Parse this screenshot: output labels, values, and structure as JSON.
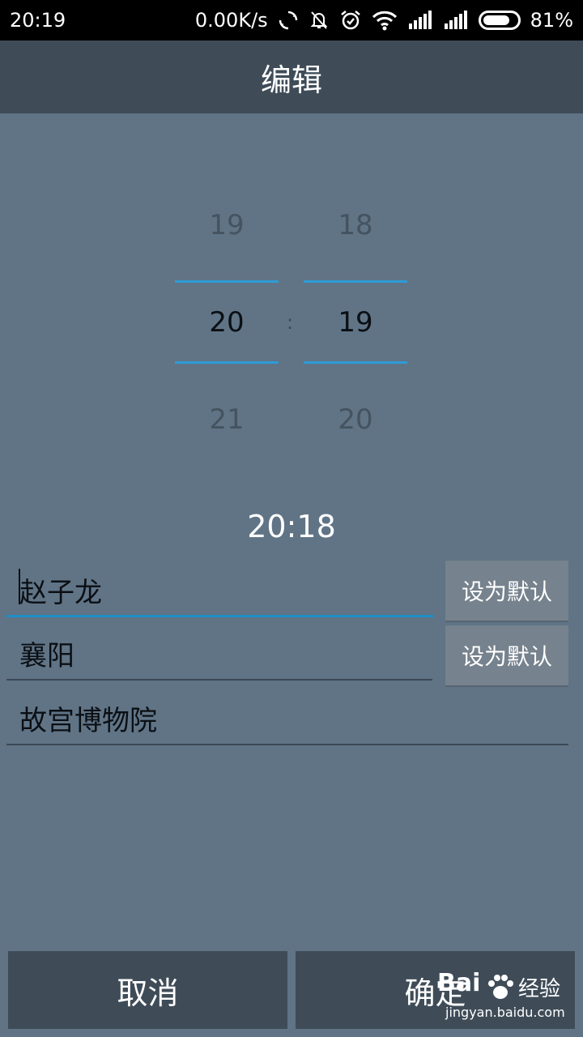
{
  "status_bar": {
    "time": "20:19",
    "speed": "0.00K/s",
    "battery": "81%",
    "battery_level": 0.81,
    "icons": [
      "sync-icon",
      "mute-bell-icon",
      "alarm-icon",
      "wifi-icon",
      "signal-icon",
      "signal-icon",
      "battery-icon"
    ]
  },
  "header": {
    "title": "编辑"
  },
  "picker": {
    "hours": {
      "prev": "19",
      "selected": "20",
      "next": "21"
    },
    "minutes": {
      "prev": "18",
      "selected": "19",
      "next": "20"
    },
    "separator": ":",
    "accent_color": "#2f9bd6"
  },
  "time_display": "20:18",
  "fields": {
    "name": "赵子龙",
    "city": "襄阳",
    "place": "故宫博物院"
  },
  "buttons": {
    "set_default_1": "设为默认",
    "set_default_2": "设为默认",
    "cancel": "取消",
    "confirm": "确定"
  },
  "watermark": {
    "logo": "Bai",
    "text": "经验",
    "url": "jingyan.baidu.com"
  }
}
